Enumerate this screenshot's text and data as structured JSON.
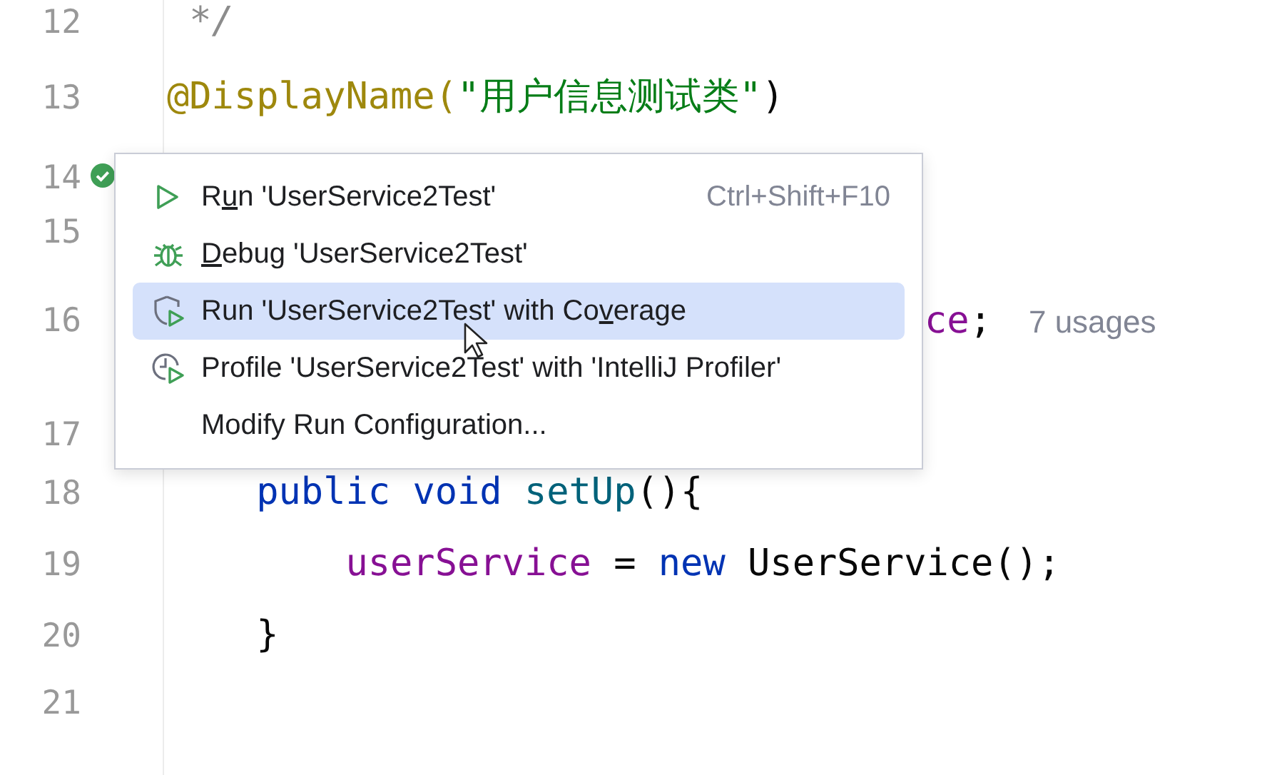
{
  "editor": {
    "lines": [
      {
        "number": "12",
        "kind": "code",
        "tokens": [
          {
            "text": " */",
            "kind": "comment"
          }
        ]
      },
      {
        "number": "13",
        "kind": "code",
        "tokens": [
          {
            "text": "@DisplayName(",
            "kind": "annotation"
          },
          {
            "text": "\"用户信息测试类\"",
            "kind": "string"
          },
          {
            "text": ")",
            "kind": "plain"
          }
        ]
      },
      {
        "number": "14",
        "kind": "runnable"
      },
      {
        "number": "15",
        "kind": "code"
      },
      {
        "number": "16",
        "kind": "occluded",
        "tokens": [
          {
            "text": "ce",
            "kind": "field"
          },
          {
            "text": ";",
            "kind": "plain"
          },
          {
            "text": "7 usages",
            "kind": "hint"
          }
        ]
      },
      {
        "number": "17",
        "kind": "spaced"
      },
      {
        "number": "18",
        "kind": "code",
        "tokens": [
          {
            "text": "    public ",
            "kind": "keyword"
          },
          {
            "text": "void ",
            "kind": "keyword"
          },
          {
            "text": "setUp",
            "kind": "method"
          },
          {
            "text": "(){",
            "kind": "plain"
          }
        ]
      },
      {
        "number": "19",
        "kind": "code",
        "tokens": [
          {
            "text": "        userService",
            "kind": "field"
          },
          {
            "text": " = ",
            "kind": "plain"
          },
          {
            "text": "new",
            "kind": "keyword"
          },
          {
            "text": " UserService();",
            "kind": "plain"
          }
        ]
      },
      {
        "number": "20",
        "kind": "code",
        "tokens": [
          {
            "text": "    }",
            "kind": "plain"
          }
        ]
      },
      {
        "number": "21",
        "kind": "code"
      }
    ]
  },
  "context_menu": {
    "items": [
      {
        "before": "R",
        "mnemonic": "u",
        "after": "n 'UserService2Test'",
        "shortcut": "Ctrl+Shift+F10",
        "selected": false
      },
      {
        "mnemonic": "D",
        "after": "ebug 'UserService2Test'",
        "selected": false
      },
      {
        "before": "Run 'UserService2Test' with Co",
        "mnemonic": "v",
        "after": "erage",
        "selected": true
      },
      {
        "before": "Profile 'UserService2Test' with 'IntelliJ Profiler'",
        "selected": false
      },
      {
        "before": "Modify Run Configuration...",
        "selected": false
      }
    ]
  }
}
